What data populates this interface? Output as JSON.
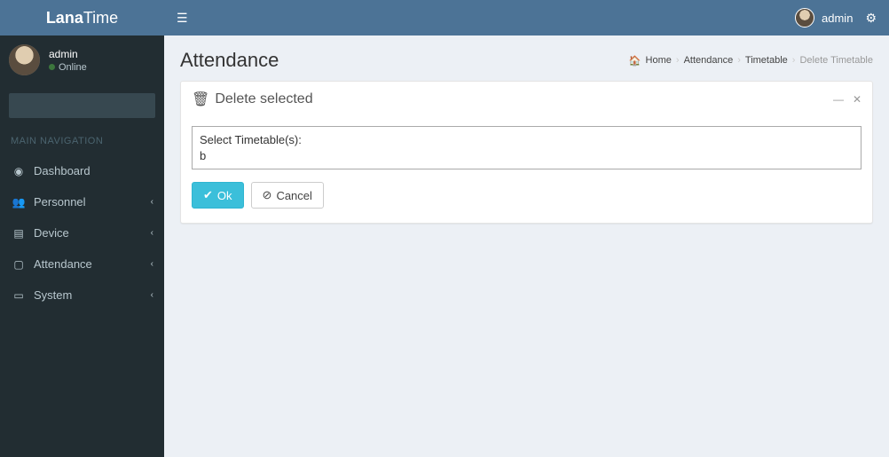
{
  "brand": {
    "bold": "Lana",
    "thin": "Time"
  },
  "user": {
    "name": "admin",
    "status": "Online"
  },
  "topbar": {
    "username": "admin"
  },
  "nav": {
    "header": "MAIN NAVIGATION",
    "items": [
      {
        "icon": "◉",
        "label": "Dashboard",
        "has_children": false
      },
      {
        "icon": "👥",
        "label": "Personnel",
        "has_children": true
      },
      {
        "icon": "▤",
        "label": "Device",
        "has_children": true
      },
      {
        "icon": "▢",
        "label": "Attendance",
        "has_children": true
      },
      {
        "icon": "▭",
        "label": "System",
        "has_children": true
      }
    ]
  },
  "page": {
    "title": "Attendance",
    "breadcrumb": {
      "home": "Home",
      "items": [
        "Attendance",
        "Timetable"
      ],
      "active": "Delete Timetable"
    }
  },
  "box": {
    "title": "Delete selected",
    "select_label": "Select Timetable(s):",
    "select_value": "b",
    "buttons": {
      "ok": "Ok",
      "cancel": "Cancel"
    }
  }
}
